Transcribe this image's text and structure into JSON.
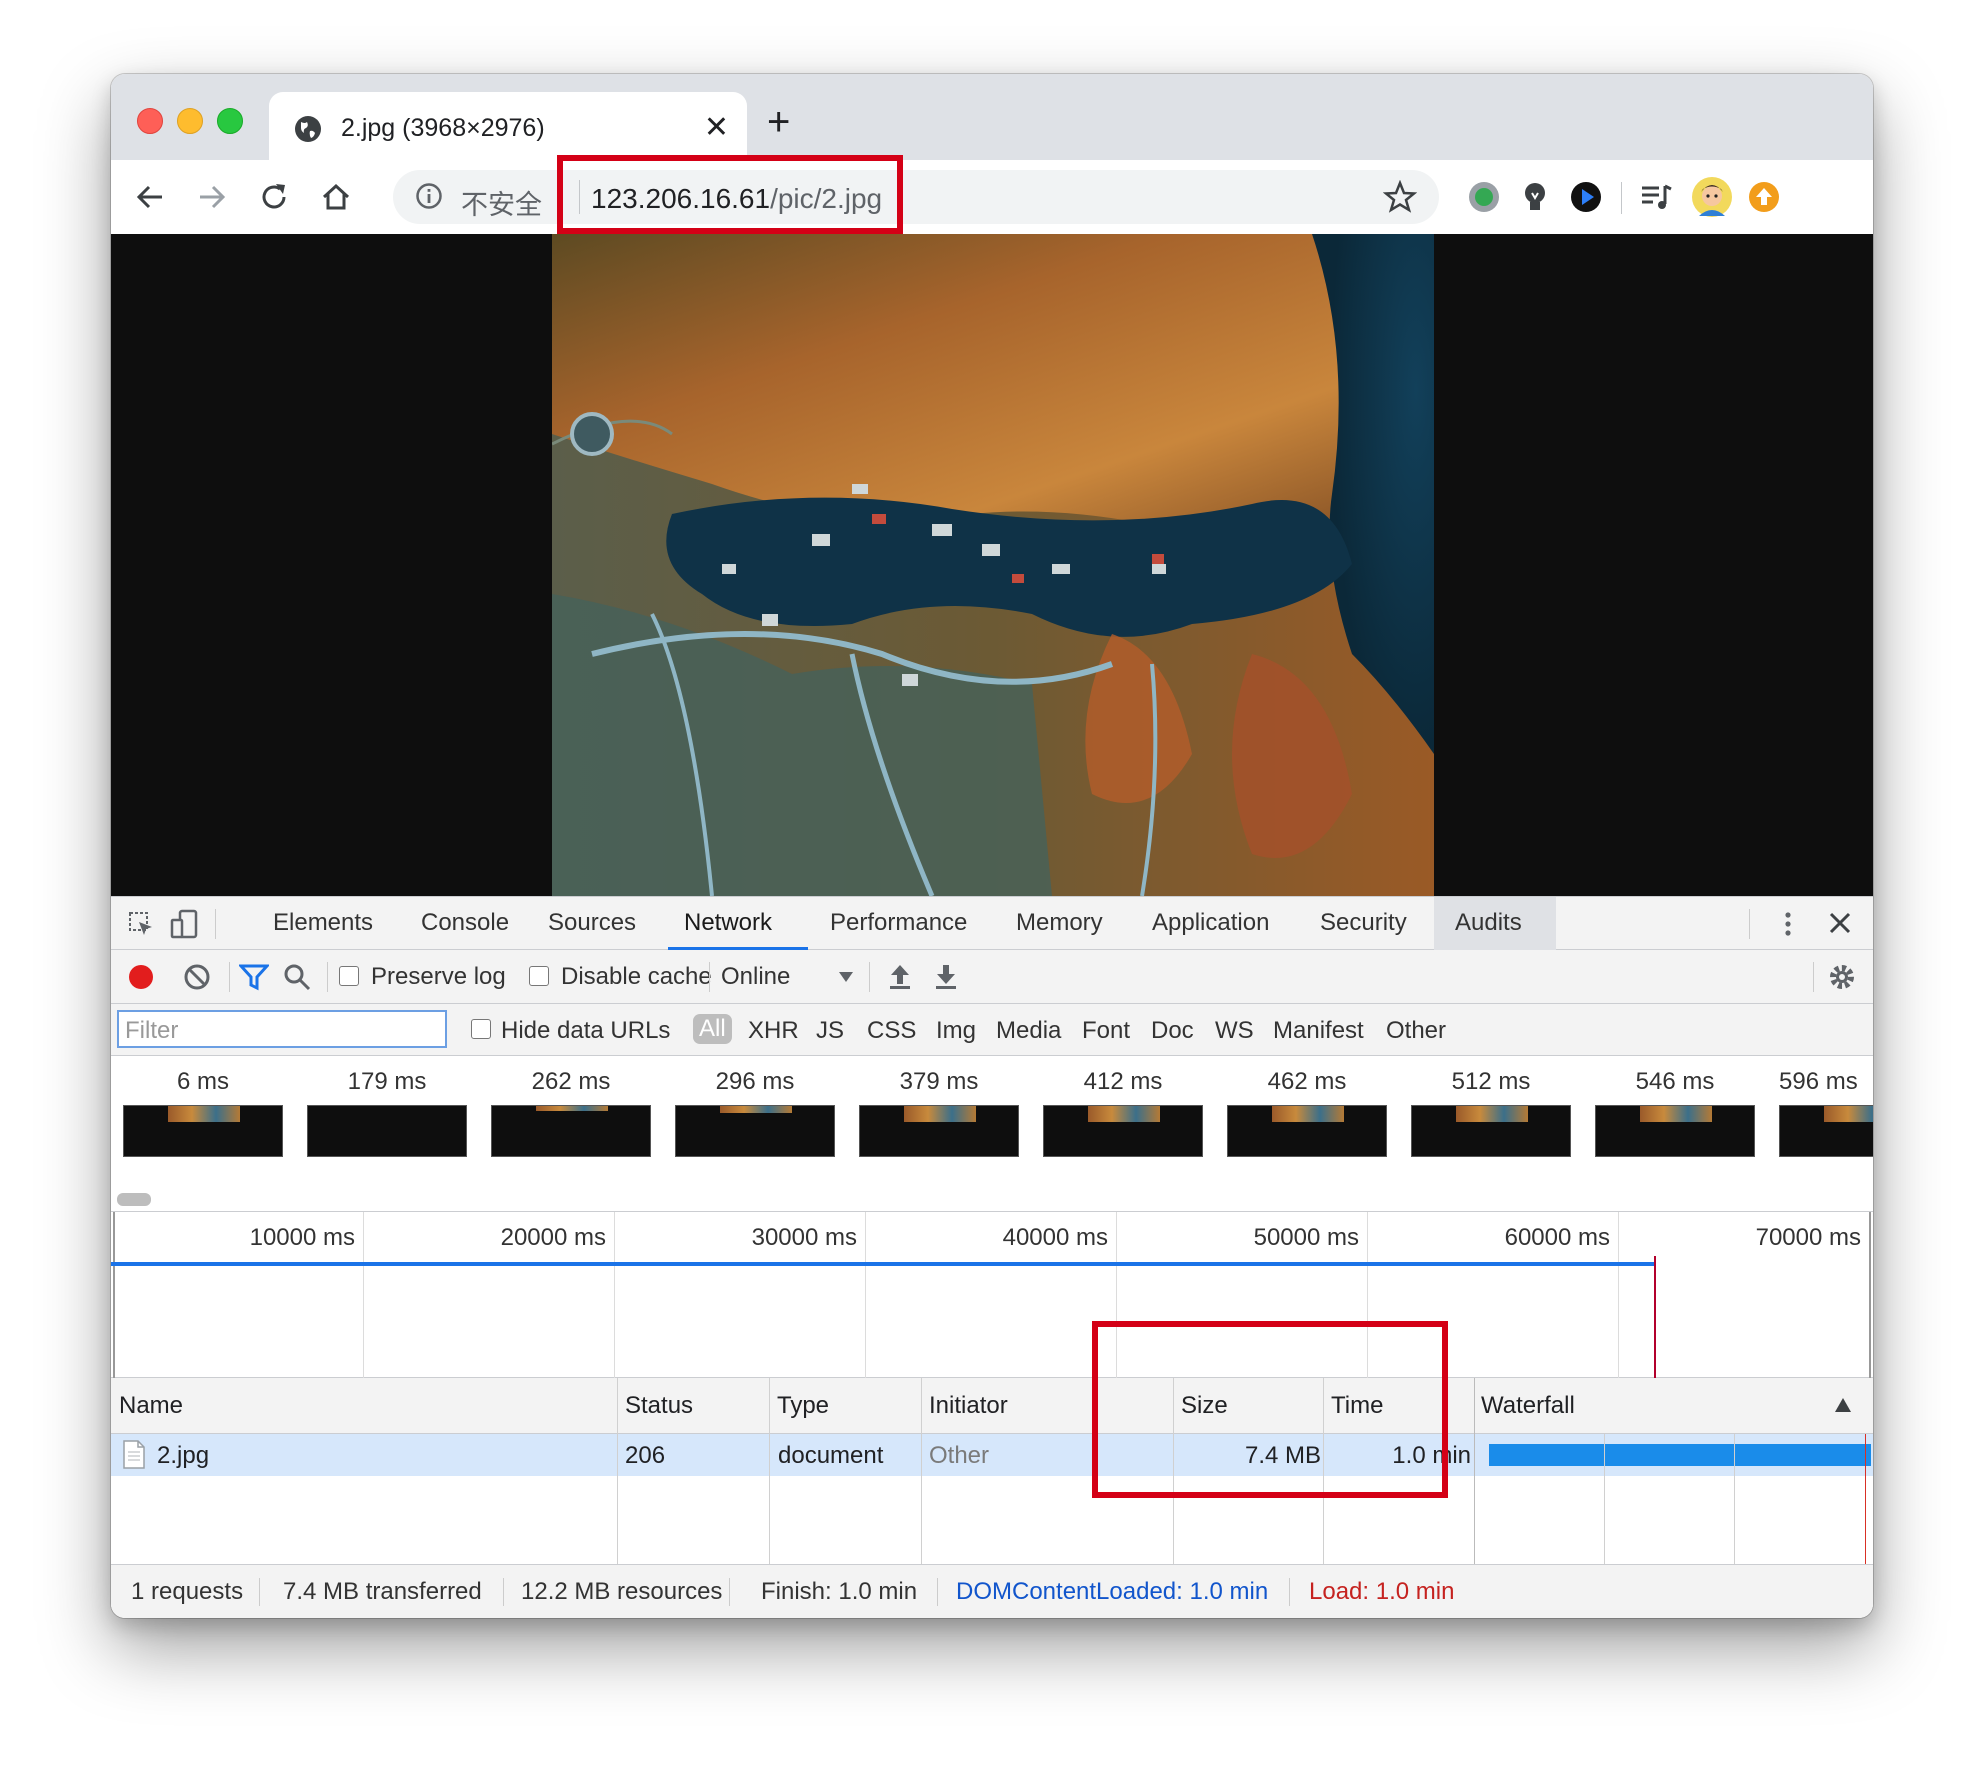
{
  "window": {
    "tab_title": "2.jpg (3968×2976)",
    "new_tab_label": "+",
    "close_tab_label": "✕"
  },
  "omnibox": {
    "security_label": "不安全",
    "url_host": "123.206.16.61",
    "url_path": "/pic/2.jpg"
  },
  "devtools": {
    "tabs": [
      "Elements",
      "Console",
      "Sources",
      "Network",
      "Performance",
      "Memory",
      "Application",
      "Security",
      "Audits"
    ],
    "active_tab": "Network",
    "toolbar": {
      "preserve_log": "Preserve log",
      "disable_cache": "Disable cache",
      "throttling": "Online"
    },
    "filter": {
      "placeholder": "Filter",
      "hide_data_urls": "Hide data URLs",
      "types": [
        "All",
        "XHR",
        "JS",
        "CSS",
        "Img",
        "Media",
        "Font",
        "Doc",
        "WS",
        "Manifest",
        "Other"
      ]
    },
    "filmstrip": [
      "6 ms",
      "179 ms",
      "262 ms",
      "296 ms",
      "379 ms",
      "412 ms",
      "462 ms",
      "512 ms",
      "546 ms",
      "596 ms"
    ],
    "overview_ticks": [
      "10000 ms",
      "20000 ms",
      "30000 ms",
      "40000 ms",
      "50000 ms",
      "60000 ms",
      "70000 ms"
    ],
    "table": {
      "columns": [
        "Name",
        "Status",
        "Type",
        "Initiator",
        "Size",
        "Time",
        "Waterfall"
      ],
      "rows": [
        {
          "name": "2.jpg",
          "status": "206",
          "type": "document",
          "initiator": "Other",
          "size": "7.4 MB",
          "time": "1.0 min"
        }
      ]
    },
    "status": {
      "requests": "1 requests",
      "transferred": "7.4 MB transferred",
      "resources": "12.2 MB resources",
      "finish": "Finish: 1.0 min",
      "dom_content_loaded": "DOMContentLoaded: 1.0 min",
      "load": "Load: 1.0 min"
    }
  },
  "colors": {
    "annotation_red": "#d40016",
    "dcl_blue": "#1155cc",
    "load_red": "#c5221f",
    "waterfall_blue": "#1a8cea"
  }
}
